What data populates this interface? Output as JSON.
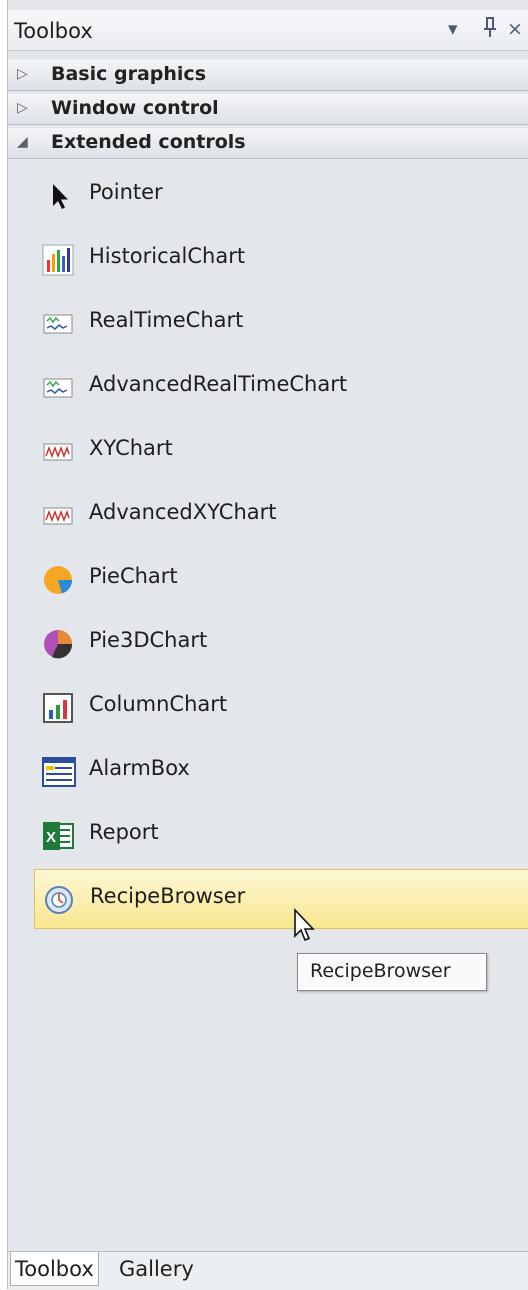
{
  "toolbox": {
    "title": "Toolbox",
    "controls": {
      "dropdown": "▾",
      "pin": "ⴿ",
      "close": "×"
    },
    "sections": [
      {
        "label": "Basic graphics",
        "state": "collapsed"
      },
      {
        "label": "Window control",
        "state": "collapsed"
      },
      {
        "label": "Extended controls",
        "state": "expanded"
      }
    ],
    "items": [
      {
        "label": "Pointer",
        "icon": "pointer-icon"
      },
      {
        "label": "HistoricalChart",
        "icon": "historical-chart-icon"
      },
      {
        "label": "RealTimeChart",
        "icon": "realtime-chart-icon"
      },
      {
        "label": "AdvancedRealTimeChart",
        "icon": "advanced-realtime-chart-icon"
      },
      {
        "label": "XYChart",
        "icon": "xy-chart-icon"
      },
      {
        "label": "AdvancedXYChart",
        "icon": "advanced-xy-chart-icon"
      },
      {
        "label": "PieChart",
        "icon": "pie-chart-icon"
      },
      {
        "label": "Pie3DChart",
        "icon": "pie3d-chart-icon"
      },
      {
        "label": "ColumnChart",
        "icon": "column-chart-icon"
      },
      {
        "label": "AlarmBox",
        "icon": "alarm-box-icon"
      },
      {
        "label": "Report",
        "icon": "excel-report-icon"
      },
      {
        "label": "RecipeBrowser",
        "icon": "recipe-browser-icon",
        "selected": true
      }
    ],
    "tooltip": "RecipeBrowser"
  },
  "tabs": [
    {
      "label": "Toolbox",
      "active": true
    },
    {
      "label": "Gallery",
      "active": false
    }
  ],
  "colors": {
    "panel_bg": "#e3e6ea",
    "selection_bg": "#f9e78f",
    "selection_border": "#e2c35a"
  }
}
